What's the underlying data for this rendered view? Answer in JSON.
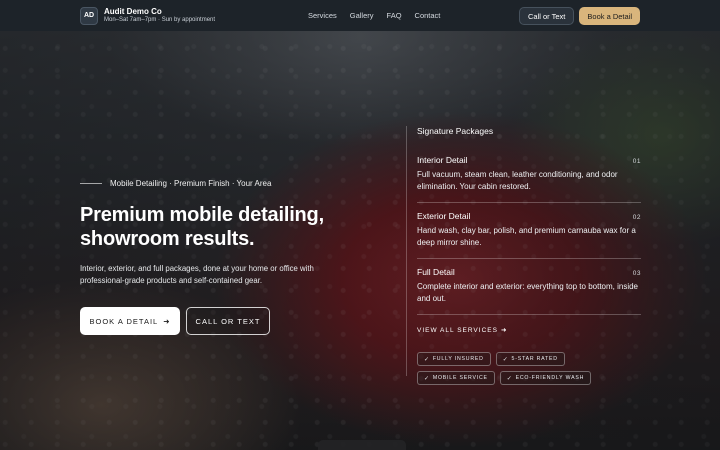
{
  "header": {
    "badge": "AD",
    "brand_name": "Audit Demo Co",
    "hours": "Mon–Sat 7am–7pm · Sun by appointment",
    "nav": [
      "Services",
      "Gallery",
      "FAQ",
      "Contact"
    ],
    "call_label": "Call or Text",
    "book_label": "Book a Detail"
  },
  "hero": {
    "eyebrow": "Mobile Detailing · Premium Finish · Your Area",
    "headline": "Premium mobile detailing, showroom results.",
    "subcopy": "Interior, exterior, and full packages, done at your home or office with professional-grade products and self-contained gear.",
    "book_cta": "BOOK A DETAIL",
    "book_arrow": "➜",
    "call_cta": "CALL OR TEXT"
  },
  "packages": {
    "title": "Signature Packages",
    "items": [
      {
        "name": "Interior Detail",
        "num": "01",
        "desc": "Full vacuum, steam clean, leather conditioning, and odor elimination. Your cabin restored."
      },
      {
        "name": "Exterior Detail",
        "num": "02",
        "desc": "Hand wash, clay bar, polish, and premium carnauba wax for a deep mirror shine."
      },
      {
        "name": "Full Detail",
        "num": "03",
        "desc": "Complete interior and exterior: everything top to bottom, inside and out."
      }
    ],
    "view_all": "VIEW ALL SERVICES",
    "view_all_arrow": "➜",
    "badges": [
      "FULLY INSURED",
      "5-STAR RATED",
      "MOBILE SERVICE",
      "ECO-FRIENDLY WASH"
    ]
  },
  "colors": {
    "accent": "#d9b57c",
    "header_bg": "#1d2329"
  }
}
